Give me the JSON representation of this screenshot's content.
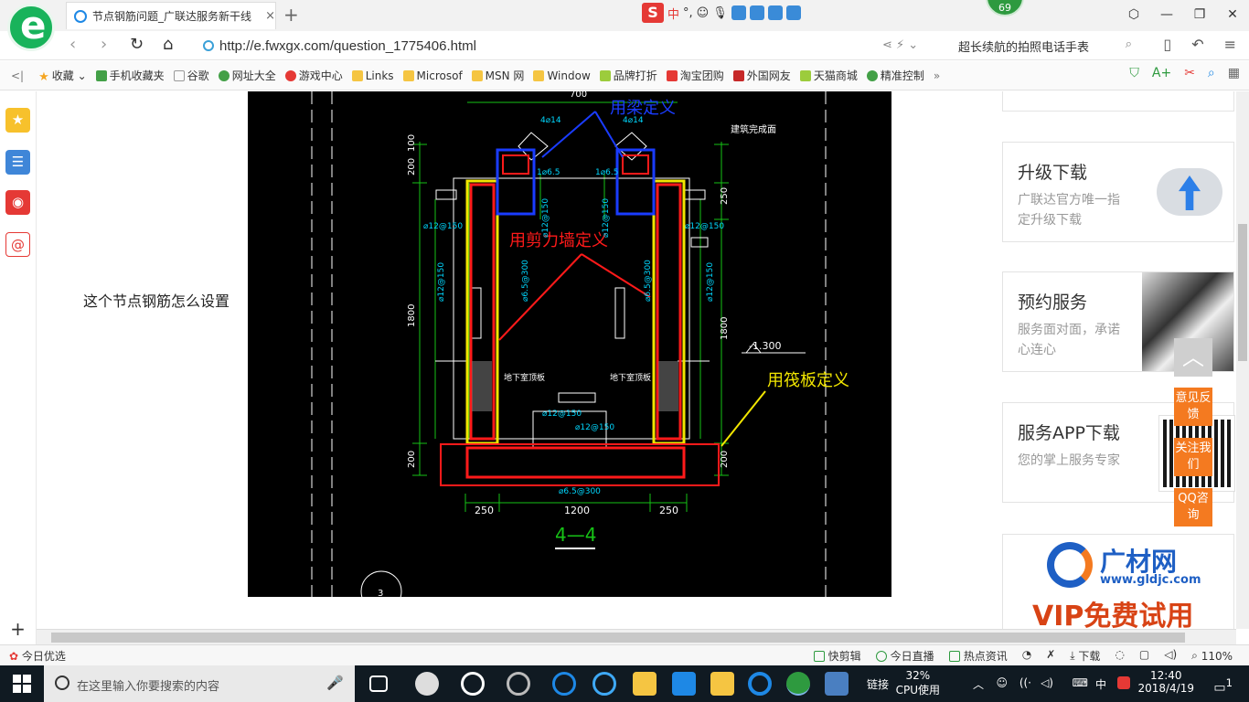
{
  "browser": {
    "tab_title": "节点钢筋问题_广联达服务新干线",
    "tab_close": "×",
    "new_tab": "+",
    "badge": "69",
    "ime_label": "中",
    "ime_punct": "°,",
    "url": "http://e.fwxgx.com/question_1775406.html",
    "search_text": "超长续航的拍照电话手表",
    "win_controls": [
      "⬡",
      "—",
      "❐",
      "✕"
    ],
    "nav_back": "‹",
    "nav_forward": "›",
    "nav_reload": "↻",
    "nav_home": "⌂",
    "nav_share": "⋖ ⚡ ⌄"
  },
  "bookmarks": [
    {
      "label": "收藏",
      "icon": "star-icon"
    },
    {
      "label": "手机收藏夹",
      "icon": "phone-icon"
    },
    {
      "label": "谷歌",
      "icon": "page-icon"
    },
    {
      "label": "网址大全",
      "icon": "globe-icon"
    },
    {
      "label": "游戏中心",
      "icon": "game-icon"
    },
    {
      "label": "Links",
      "icon": "folder-icon"
    },
    {
      "label": "Microsof",
      "icon": "folder-icon"
    },
    {
      "label": "MSN 网",
      "icon": "folder-icon"
    },
    {
      "label": "Window",
      "icon": "folder-icon"
    },
    {
      "label": "品牌打折",
      "icon": "tag-icon"
    },
    {
      "label": "淘宝团购",
      "icon": "taobao-icon"
    },
    {
      "label": "外国网友",
      "icon": "bookmark-icon"
    },
    {
      "label": "天猫商城",
      "icon": "tmall-icon"
    },
    {
      "label": "精准控制",
      "icon": "chat-icon"
    }
  ],
  "bookmarks_more": "»",
  "content": {
    "question_text": "这个节点钢筋怎么设置"
  },
  "drawing": {
    "ann_beam": "用梁定义",
    "ann_wall": "用剪力墙定义",
    "ann_raft": "用筏板定义",
    "section_label": "4—4",
    "elevation": "-1.300",
    "dim_700": "700",
    "dim_250_top": "250",
    "dim_200_top": "200",
    "dim_100": "100",
    "dim_1800_left": "1800",
    "dim_1800_right": "1800",
    "dim_200_left": "200",
    "dim_200_right": "200",
    "dim_250_bl": "250",
    "dim_1200": "1200",
    "dim_250_br": "250",
    "rebar_4_14_l": "4⌀14",
    "rebar_4_14_r": "4⌀14",
    "rebar_65_l": "1⌀6.5",
    "rebar_65_r": "1⌀6.5",
    "rebar_12150_a": "⌀12@150",
    "rebar_12150_b": "⌀12@150",
    "rebar_12150_c": "⌀12@150",
    "rebar_12150_d": "⌀12@150",
    "rebar_12150_e": "⌀12@150",
    "rebar_12150_f": "⌀12@150",
    "rebar_12150_g": "⌀12@150",
    "rebar_12150_h": "⌀12@150",
    "rebar_65300_l": "⌀6.5@300",
    "rebar_65300_r": "⌀6.5@300",
    "rebar_65300_b": "⌀6.5@300",
    "base_label_l": "地下室顶板",
    "base_label_r": "地下室顶板",
    "title_right": "建筑完成面",
    "circle_num": "3"
  },
  "right_cards": [
    {
      "title": "升级下载",
      "desc": "广联达官方唯一指定升级下载"
    },
    {
      "title": "预约服务",
      "desc": "服务面对面，承诺心连心"
    },
    {
      "title": "服务APP下载",
      "desc": "您的掌上服务专家"
    }
  ],
  "float_buttons": [
    "意见反馈",
    "关注我们",
    "QQ咨询"
  ],
  "float_top": "︿",
  "promo": {
    "brand": "广材网",
    "site": "www.gldjc.com",
    "vip": "VIP免费试用"
  },
  "statusbar": {
    "left": "今日优选",
    "items": [
      "快剪辑",
      "今日直播",
      "热点资讯",
      "下载",
      "110%"
    ]
  },
  "taskbar": {
    "search_placeholder": "在这里输入你要搜索的内容",
    "mic": "🎤",
    "links": "链接",
    "cpu_percent": "32%",
    "cpu_label": "CPU使用",
    "ime": "中",
    "time": "12:40",
    "date": "2018/4/19",
    "notif_count": "1"
  }
}
